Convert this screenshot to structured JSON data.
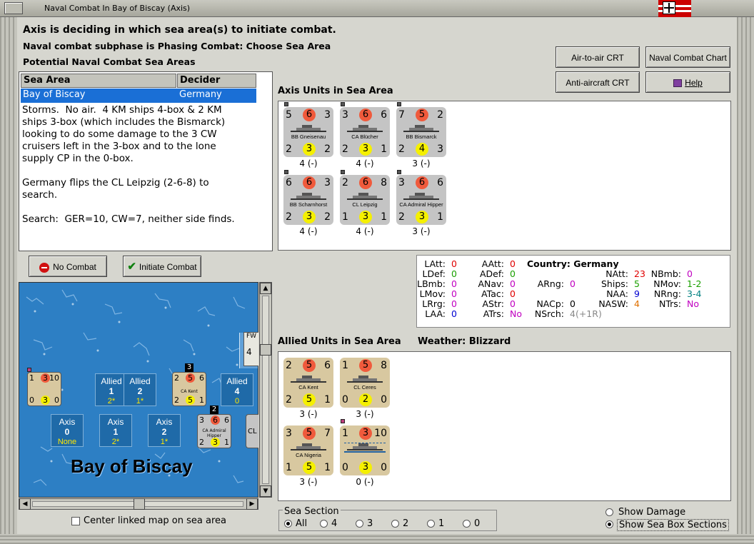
{
  "window": {
    "title": "Naval Combat In Bay of Biscay (Axis)"
  },
  "header": {
    "line1": "Axis is deciding in which sea area(s) to initiate combat.",
    "line2": "Naval combat subphase is Phasing Combat: Choose Sea Area",
    "line3": "Potential Naval Combat Sea Areas"
  },
  "buttons": {
    "air_to_air": "Air-to-air CRT",
    "naval_chart": "Naval Combat Chart",
    "anti_aircraft": "Anti-aircraft CRT",
    "help": "Help",
    "no_combat": "No Combat",
    "initiate_combat": "Initiate Combat"
  },
  "sea_table": {
    "col_sea_area": "Sea Area",
    "col_decider": "Decider",
    "row_sea_area": "Bay of Biscay",
    "row_decider": "Germany",
    "notes": "Storms.  No air.  4 KM ships 4-box & 2 KM\nships 3-box (which includes the Bismarck)\nlooking to do some damage to the 3 CW\ncruisers left in the 3-box and to the lone\nsupply CP in the 0-box.\n\nGermany flips the CL Leipzig (2-6-8) to\nsearch.\n\nSearch:  GER=10, CW=7, neither side finds."
  },
  "axis_units": {
    "label": "Axis Units in Sea Area",
    "units": [
      {
        "tl": "5",
        "tc": "6",
        "tr": "3",
        "name": "BB Gneisenau",
        "bl": "2",
        "bc": "3",
        "br": "2",
        "count": "4 (-)"
      },
      {
        "tl": "3",
        "tc": "6",
        "tr": "6",
        "name": "CA Blücher",
        "bl": "2",
        "bc": "3",
        "br": "1",
        "count": "4 (-)"
      },
      {
        "tl": "7",
        "tc": "5",
        "tr": "2",
        "name": "BB Bismarck",
        "bl": "2",
        "bc": "4",
        "br": "3",
        "count": "3 (-)"
      },
      {
        "tl": "6",
        "tc": "6",
        "tr": "3",
        "name": "BB Scharnhorst",
        "bl": "2",
        "bc": "3",
        "br": "2",
        "count": "4 (-)"
      },
      {
        "tl": "2",
        "tc": "6",
        "tr": "8",
        "name": "CL Leipzig",
        "bl": "1",
        "bc": "3",
        "br": "1",
        "count": "4 (-)"
      },
      {
        "tl": "3",
        "tc": "6",
        "tr": "6",
        "name": "CA Admiral Hipper",
        "bl": "2",
        "bc": "3",
        "br": "1",
        "count": "3 (-)"
      }
    ]
  },
  "stats": {
    "latt": "LAtt:",
    "latt_v": "0",
    "ldef": "LDef:",
    "ldef_v": "0",
    "lbmb": "LBmb:",
    "lbmb_v": "0",
    "lmov": "LMov:",
    "lmov_v": "0",
    "lrg": "LRrg:",
    "lrg_v": "0",
    "laa": "LAA:",
    "laa_v": "0",
    "aatt": "AAtt:",
    "aatt_v": "0",
    "adef": "ADef:",
    "adef_v": "0",
    "anav": "ANav:",
    "anav_v": "0",
    "atac": "ATac:",
    "atac_v": "0",
    "astr": "AStr:",
    "astr_v": "0",
    "atrs": "ATrs:",
    "atrs_v": "No",
    "country": "Country: Germany",
    "arng": "ARng:",
    "arng_v": "0",
    "nacp": "NACp:",
    "nacp_v": "0",
    "nsrch": "NSrch:",
    "nsrch_v": "4(+1R)",
    "natt": "NAtt:",
    "natt_v": "23",
    "ships": "Ships:",
    "ships_v": "5",
    "naa": "NAA:",
    "naa_v": "9",
    "nasw": "NASW:",
    "nasw_v": "4",
    "nbmb": "NBmb:",
    "nbmb_v": "0",
    "nmov": "NMov:",
    "nmov_v": "1-2",
    "nrng": "NRng:",
    "nrng_v": "3-4",
    "ntrs": "NTrs:",
    "ntrs_v": "No",
    "colors": {
      "red": "#e00000",
      "green": "#1aa000",
      "purple": "#c000c0",
      "blue": "#0000d0",
      "orange": "#e07000",
      "teal": "#008080",
      "grey": "#888888"
    }
  },
  "allied_units": {
    "label": "Allied Units in Sea Area",
    "weather": "Weather:  Blizzard",
    "units": [
      {
        "tl": "2",
        "tc": "5",
        "tr": "6",
        "name": "CA Kent",
        "bl": "2",
        "bc": "5",
        "br": "1",
        "count": "3 (-)"
      },
      {
        "tl": "1",
        "tc": "5",
        "tr": "8",
        "name": "CL Ceres",
        "bl": "0",
        "bc": "2",
        "br": "0",
        "count": "3 (-)"
      },
      {
        "tl": "3",
        "tc": "5",
        "tr": "7",
        "name": "CA Nigeria",
        "bl": "1",
        "bc": "5",
        "br": "1",
        "count": "3 (-)"
      },
      {
        "tl": "1",
        "tc": "3",
        "tr": "10",
        "name": "",
        "bl": "0",
        "bc": "3",
        "br": "0",
        "count": "0 (-)"
      }
    ]
  },
  "map": {
    "title": "Bay of Biscay",
    "allied_boxes": [
      {
        "side": "Allied",
        "num": "1",
        "sub": "2*"
      },
      {
        "side": "Allied",
        "num": "2",
        "sub": "1*"
      },
      {
        "side": "Allied",
        "num": "4",
        "sub": "0"
      }
    ],
    "axis_boxes": [
      {
        "side": "Axis",
        "num": "0",
        "sub": "None"
      },
      {
        "side": "Axis",
        "num": "1",
        "sub": "2*"
      },
      {
        "side": "Axis",
        "num": "2",
        "sub": "1*"
      }
    ],
    "marker_3": "3",
    "marker_2": "2",
    "ca_kent": {
      "tl": "2",
      "tc": "5",
      "tr": "6",
      "name": "CA Kent",
      "bl": "2",
      "bc": "5",
      "br": "1"
    },
    "ca_hipper": {
      "tl": "3",
      "tc": "6",
      "tr": "6",
      "name": "CA Admiral Hipper",
      "bl": "2",
      "bc": "3",
      "br": "1"
    },
    "cp": {
      "tl": "1",
      "tc": "3",
      "tr": "10",
      "bl": "0",
      "bc": "3",
      "br": "0"
    },
    "cl_edge": "CL",
    "fw": "FW",
    "fw_num": "4",
    "center_linked": "Center linked map on sea area"
  },
  "sea_section": {
    "label": "Sea Section",
    "options": [
      "All",
      "4",
      "3",
      "2",
      "1",
      "0"
    ],
    "selected": "All"
  },
  "options": {
    "show_damage": "Show Damage",
    "show_sections": "Show Sea Box Sections"
  }
}
